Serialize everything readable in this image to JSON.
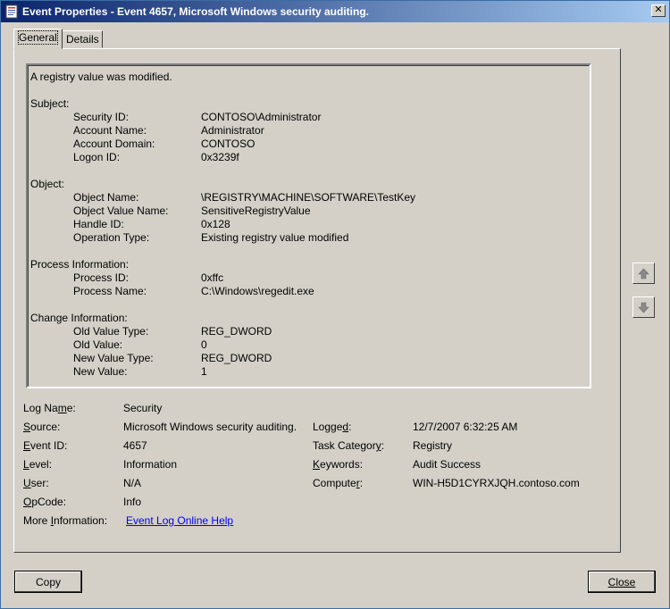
{
  "window": {
    "title": "Event Properties - Event 4657, Microsoft Windows security auditing."
  },
  "tabs": [
    {
      "label": "General"
    },
    {
      "label": "Details"
    }
  ],
  "description": {
    "headline": "A registry value was modified.",
    "sections": [
      {
        "title": "Subject:",
        "rows": [
          {
            "label": "Security ID:",
            "value": "CONTOSO\\Administrator"
          },
          {
            "label": "Account Name:",
            "value": "Administrator"
          },
          {
            "label": "Account Domain:",
            "value": "CONTOSO"
          },
          {
            "label": "Logon ID:",
            "value": "0x3239f"
          }
        ]
      },
      {
        "title": "Object:",
        "rows": [
          {
            "label": "Object Name:",
            "value": "\\REGISTRY\\MACHINE\\SOFTWARE\\TestKey"
          },
          {
            "label": "Object Value Name:",
            "value": "SensitiveRegistryValue"
          },
          {
            "label": "Handle ID:",
            "value": "0x128"
          },
          {
            "label": "Operation Type:",
            "value": "Existing registry value modified"
          }
        ]
      },
      {
        "title": "Process Information:",
        "rows": [
          {
            "label": "Process ID:",
            "value": "0xffc"
          },
          {
            "label": "Process Name:",
            "value": "C:\\Windows\\regedit.exe"
          }
        ]
      },
      {
        "title": "Change Information:",
        "rows": [
          {
            "label": "Old Value Type:",
            "value": "REG_DWORD"
          },
          {
            "label": "Old Value:",
            "value": "0"
          },
          {
            "label": "New Value Type:",
            "value": "REG_DWORD"
          },
          {
            "label": "New Value:",
            "value": "1"
          }
        ]
      }
    ]
  },
  "fields": {
    "log_name": {
      "label": "Log Name:",
      "value": "Security"
    },
    "source": {
      "label": "Source:",
      "value": "Microsoft Windows security auditing."
    },
    "event_id": {
      "label": "Event ID:",
      "value": "4657"
    },
    "level": {
      "label": "Level:",
      "value": "Information"
    },
    "user": {
      "label": "User:",
      "value": "N/A"
    },
    "opcode": {
      "label": "OpCode:",
      "value": "Info"
    },
    "more_info": {
      "label": "More Information:",
      "value": "Event Log Online Help"
    },
    "logged": {
      "label": "Logged:",
      "value": "12/7/2007 6:32:25 AM"
    },
    "task_category": {
      "label": "Task Category:",
      "value": "Registry"
    },
    "keywords": {
      "label": "Keywords:",
      "value": "Audit Success"
    },
    "computer": {
      "label": "Computer:",
      "value": "WIN-H5D1CYRXJQH.contoso.com"
    }
  },
  "buttons": {
    "copy": "Copy",
    "close": "Close"
  },
  "icons": {
    "title_icon": "event-viewer-icon",
    "up": "arrow-up-icon",
    "down": "arrow-down-icon"
  }
}
